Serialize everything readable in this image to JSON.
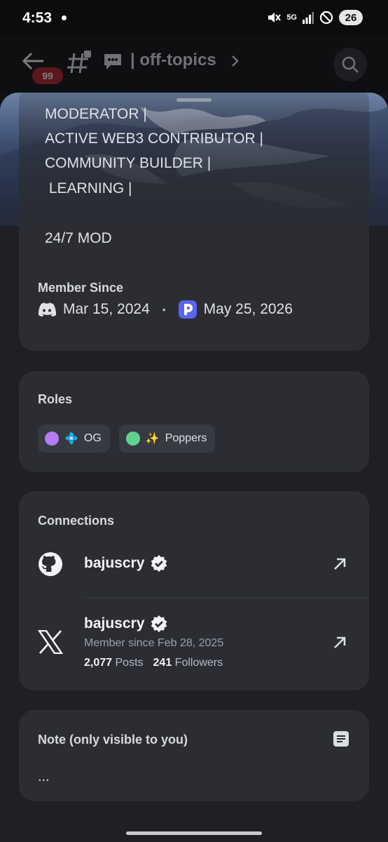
{
  "status_bar": {
    "time": "4:53",
    "network": "5G",
    "battery": "26"
  },
  "channel_header": {
    "unread_count": "99",
    "channel_name": "| off-topics"
  },
  "about": {
    "bio_lines": [
      "MODERATOR |",
      "ACTIVE WEB3 CONTRIBUTOR |",
      "COMMUNITY BUILDER |",
      " LEARNING |",
      "",
      "24/7 MOD"
    ],
    "member_since_title": "Member Since",
    "discord_date": "Mar 15, 2024",
    "separator": "•",
    "server_date": "May 25, 2026"
  },
  "roles": {
    "title": "Roles",
    "items": [
      {
        "emoji": "💠",
        "label": "OG",
        "color": "#b57cf5"
      },
      {
        "emoji": "✨",
        "label": "Poppers",
        "color": "#5fd38d"
      }
    ]
  },
  "connections": {
    "title": "Connections",
    "github": {
      "username": "bajuscry"
    },
    "x": {
      "username": "bajuscry",
      "member_since": "Member since Feb 28, 2025",
      "posts_value": "2,077",
      "posts_label": "Posts",
      "followers_value": "241",
      "followers_label": "Followers"
    }
  },
  "note": {
    "title": "Note (only visible to you)",
    "value": "..."
  },
  "colors": {
    "sheet": "#1f2025",
    "card": "#2b2d33",
    "accent": "#5865f2",
    "badge": "#b3202a"
  }
}
